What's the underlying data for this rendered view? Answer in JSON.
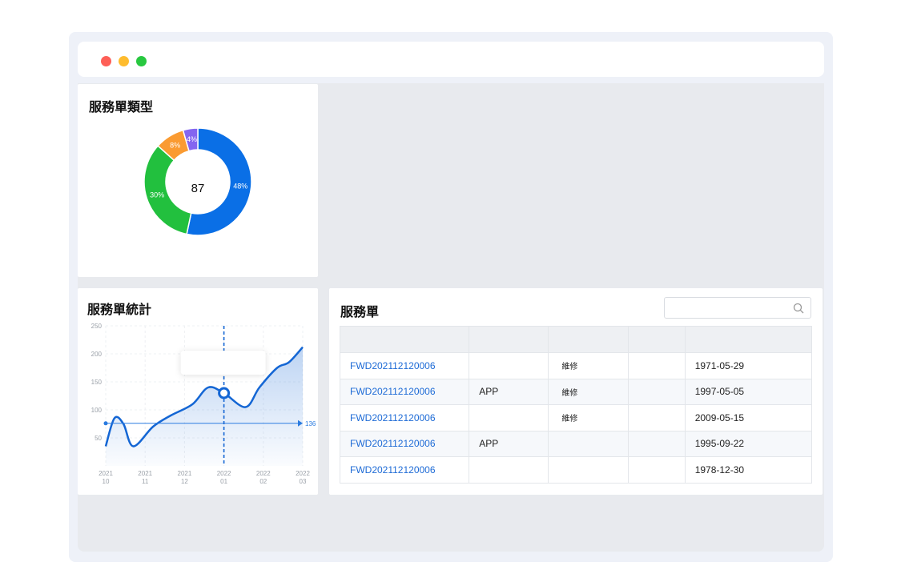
{
  "window": {
    "controls": [
      {
        "name": "close",
        "color": "#fe5f57"
      },
      {
        "name": "minimize",
        "color": "#febc2e"
      },
      {
        "name": "maximize",
        "color": "#28c840"
      }
    ]
  },
  "type_card": {
    "title": "服務單類型",
    "center_value": "87",
    "chart_data": {
      "type": "pie",
      "slices": [
        {
          "label": "48%",
          "value": 48,
          "color": "#0a6fe6"
        },
        {
          "label": "30%",
          "value": 30,
          "color": "#22c03e"
        },
        {
          "label": "8%",
          "value": 8,
          "color": "#fa9b32"
        },
        {
          "label": "4%",
          "value": 4,
          "color": "#8466f0"
        }
      ]
    }
  },
  "stats_card": {
    "title": "服務單統計",
    "marker_label": "136",
    "chart_data": {
      "type": "area",
      "ylim": [
        0,
        250
      ],
      "yticks": [
        "250",
        "200",
        "150",
        "100",
        "50"
      ],
      "xticks": [
        {
          "year": "2021",
          "month": "10"
        },
        {
          "year": "2021",
          "month": "11"
        },
        {
          "year": "2021",
          "month": "12"
        },
        {
          "year": "2022",
          "month": "01"
        },
        {
          "year": "2022",
          "month": "02"
        },
        {
          "year": "2022",
          "month": "03"
        }
      ],
      "color": "#1466d4",
      "series": [
        {
          "values": [
            [
              0,
              35
            ],
            [
              0.22,
              85
            ],
            [
              0.45,
              75
            ],
            [
              0.7,
              35
            ],
            [
              1.2,
              70
            ],
            [
              1.65,
              90
            ],
            [
              2.2,
              110
            ],
            [
              2.6,
              140
            ],
            [
              3.0,
              130
            ],
            [
              3.55,
              105
            ],
            [
              3.9,
              140
            ],
            [
              4.35,
              175
            ],
            [
              4.65,
              185
            ],
            [
              5.0,
              212
            ]
          ]
        }
      ],
      "highlight_x_index": 3
    }
  },
  "orders_card": {
    "title": "服務單",
    "search_placeholder": "",
    "columns": [
      "",
      "",
      "",
      "",
      ""
    ],
    "rows": [
      {
        "id": "FWD202112120006",
        "source": "",
        "type": "維修",
        "extra": "",
        "date": "1971-05-29"
      },
      {
        "id": "FWD202112120006",
        "source": "APP",
        "type": "維修",
        "extra": "",
        "date": "1997-05-05"
      },
      {
        "id": "FWD202112120006",
        "source": "",
        "type": "維修",
        "extra": "",
        "date": "2009-05-15"
      },
      {
        "id": "FWD202112120006",
        "source": "APP",
        "type": "",
        "extra": "",
        "date": "1995-09-22"
      },
      {
        "id": "FWD202112120006",
        "source": "",
        "type": "",
        "extra": "",
        "date": "1978-12-30"
      }
    ]
  }
}
